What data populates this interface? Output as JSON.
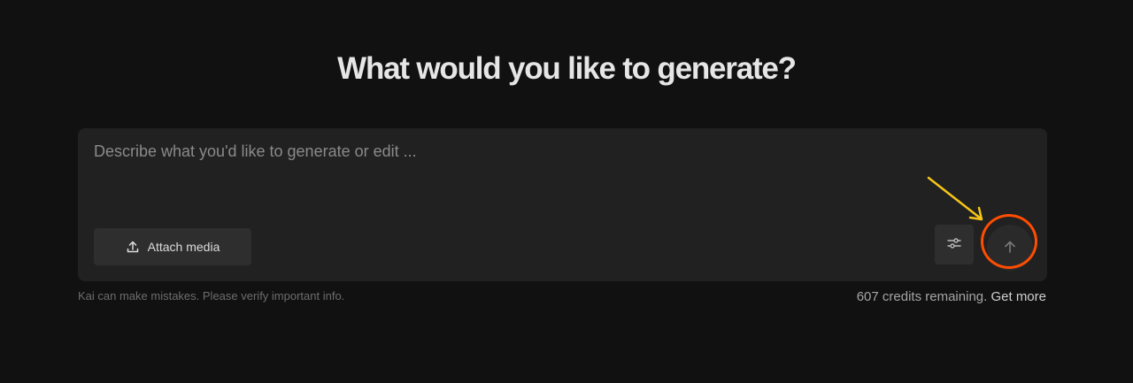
{
  "heading": "What would you like to generate?",
  "composer": {
    "placeholder": "Describe what you'd like to generate or edit ...",
    "value": "",
    "attach_label": "Attach media",
    "attach_icon": "upload-icon",
    "settings_icon": "sliders-icon",
    "send_icon": "arrow-up-icon"
  },
  "footer": {
    "disclaimer": "Kai can make mistakes. Please verify important info.",
    "credits_text": "607 credits remaining.",
    "get_more_label": "Get more"
  },
  "colors": {
    "background": "#111111",
    "panel": "#212121",
    "button": "#2e2e2e",
    "highlight_ring": "#ff4d00",
    "annotation_arrow": "#f5c518"
  }
}
